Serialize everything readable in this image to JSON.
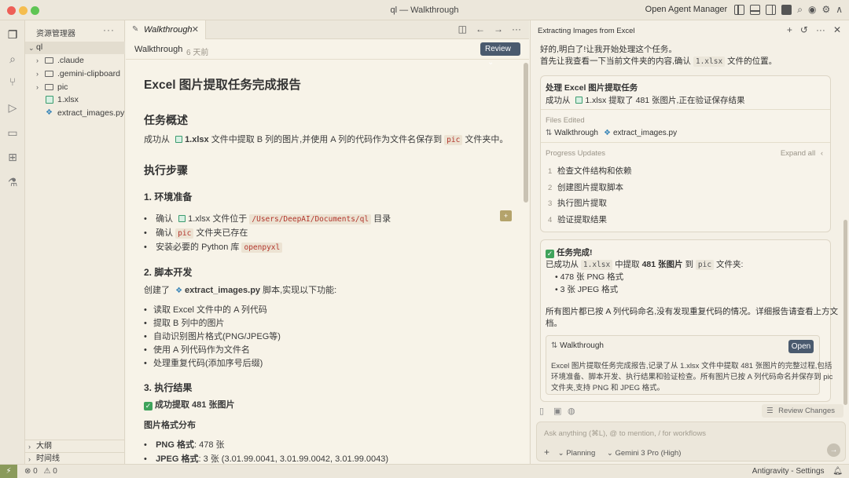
{
  "window": {
    "title": "ql — Walkthrough"
  },
  "titlebar": {
    "agent_manager": "Open Agent Manager"
  },
  "sidebar": {
    "header": "资源管理器",
    "root": "ql",
    "items": [
      ".claude",
      ".gemini-clipboard",
      "pic",
      "1.xlsx",
      "extract_images.py"
    ],
    "outline": "大纲",
    "timeline": "时间线"
  },
  "editor": {
    "tab_label": "Walkthrough",
    "header_title": "Walkthrough",
    "header_time": "6 天前",
    "review_label": "Review",
    "doc": {
      "h1": "Excel 图片提取任务完成报告",
      "overview_h": "任务概述",
      "overview_p1": "成功从",
      "overview_file": "1.xlsx",
      "overview_p2": "文件中提取 B 列的图片,并使用 A 列的代码作为文件名保存到",
      "overview_code": "pic",
      "overview_p3": "文件夹中。",
      "steps_h": "执行步骤",
      "env_h": "1. 环境准备",
      "env_b1_a": "确认",
      "env_b1_file": "1.xlsx",
      "env_b1_b": "文件位于",
      "env_b1_code": "/Users/DeepAI/Documents/ql",
      "env_b1_c": "目录",
      "env_b2_a": "确认",
      "env_b2_code": "pic",
      "env_b2_b": "文件夹已存在",
      "env_b3_a": "安装必要的 Python 库",
      "env_b3_code": "openpyxl",
      "script_h": "2. 脚本开发",
      "script_p_a": "创建了",
      "script_p_file": "extract_images.py",
      "script_p_b": "脚本,实现以下功能:",
      "script_bullets": [
        "读取 Excel 文件中的 A 列代码",
        "提取 B 列中的图片",
        "自动识别图片格式(PNG/JPEG等)",
        "使用 A 列代码作为文件名",
        "处理重复代码(添加序号后缀)"
      ],
      "result_h": "3. 执行结果",
      "result_ok": "成功提取 481 张图片",
      "dist_h": "图片格式分布",
      "png_label": "PNG 格式",
      "png_value": ": 478 张",
      "jpeg_label": "JPEG 格式",
      "jpeg_value": ": 3 张 (3.01.99.0041, 3.01.99.0042, 3.01.99.0043)"
    }
  },
  "agent": {
    "title": "Extracting Images from Excel",
    "msg1": "好的,明白了!让我开始处理这个任务。",
    "msg2_a": "首先让我查看一下当前文件夹的内容,确认",
    "msg2_code": "1.xlsx",
    "msg2_b": "文件的位置。",
    "task_card": {
      "title": "处理 Excel 图片提取任务",
      "text_a": "成功从",
      "text_file": "1.xlsx",
      "text_b": "提取了 481 张图片,正在验证保存结果",
      "files_label": "Files Edited",
      "file1": "Walkthrough",
      "file2": "extract_images.py",
      "progress_label": "Progress Updates",
      "expand": "Expand all",
      "steps": [
        "检查文件结构和依赖",
        "创建图片提取脚本",
        "执行图片提取",
        "验证提取结果"
      ]
    },
    "done_card": {
      "title": "任务完成!",
      "line_a": "已成功从",
      "line_code1": "1.xlsx",
      "line_b": "中提取",
      "line_bold": "481 张图片",
      "line_c": "到",
      "line_code2": "pic",
      "line_d": "文件夹:",
      "b1": "478 张 PNG 格式",
      "b2": "3 张 JPEG 格式",
      "para1": "所有图片都已按 A 列代码命名,没有发现重复代码的情况。详细报告请查看上方文",
      "para2": "档。",
      "inner_title": "Walkthrough",
      "open_label": "Open",
      "inner_l1": "Excel 图片提取任务完成报告,记录了从 1.xlsx 文件中提取 481 张图片的完整过程,包括",
      "inner_l2": "环境准备、脚本开发、执行结果和验证检查。所有图片已按 A 列代码命名并保存到 pic",
      "inner_l3": "文件夹,支持 PNG 和 JPEG 格式。"
    },
    "review_changes": "Review Changes",
    "input_placeholder": "Ask anything (⌘L), @ to mention, / for workflows",
    "mode": "Planning",
    "model": "Gemini 3 Pro (High)"
  },
  "statusbar": {
    "errors": "0",
    "warnings": "0",
    "right": "Antigravity - Settings"
  },
  "colors": {
    "accent_button": "#4a5a6e",
    "background": "#f3efe4"
  }
}
